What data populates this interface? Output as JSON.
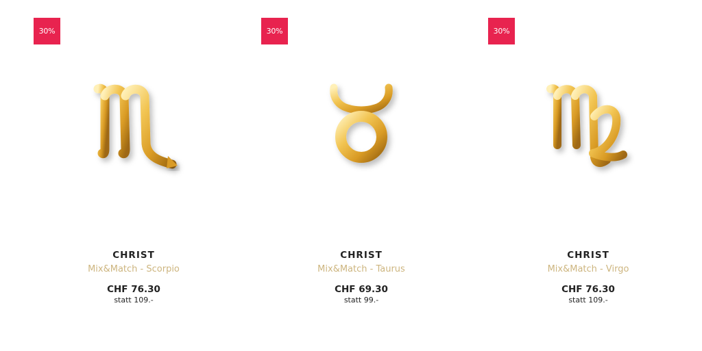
{
  "theme": {
    "badge_color": "#e8234f",
    "product_name_color": "#cdb57f",
    "gold_light": "#ffe9a6",
    "gold_mid": "#e6b43a",
    "gold_dark": "#a8731a"
  },
  "products": [
    {
      "badge": "30%",
      "brand": "CHRIST",
      "name": "Mix&Match - Scorpio",
      "price": "CHF 76.30",
      "old_price": "statt 109.-",
      "image_icon": "scorpio-zodiac-charm"
    },
    {
      "badge": "30%",
      "brand": "CHRIST",
      "name": "Mix&Match - Taurus",
      "price": "CHF 69.30",
      "old_price": "statt 99.-",
      "image_icon": "taurus-zodiac-charm"
    },
    {
      "badge": "30%",
      "brand": "CHRIST",
      "name": "Mix&Match - Virgo",
      "price": "CHF 76.30",
      "old_price": "statt 109.-",
      "image_icon": "virgo-zodiac-charm"
    }
  ]
}
